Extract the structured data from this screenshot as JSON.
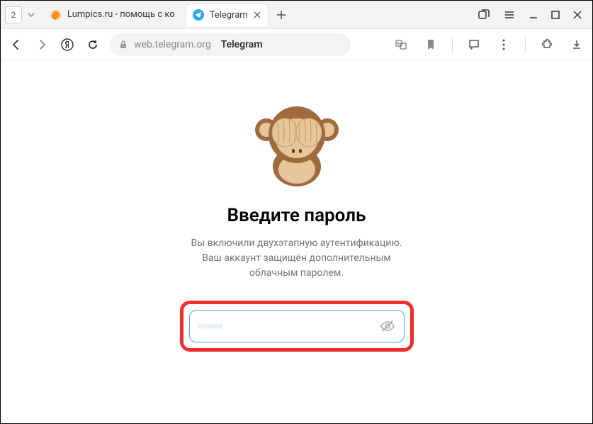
{
  "titlebar": {
    "tab_count": "2",
    "tabs": [
      {
        "title": "Lumpics.ru - помощь с ко"
      },
      {
        "title": "Telegram"
      }
    ]
  },
  "toolbar": {
    "domain": "web.telegram.org",
    "page_title": "Telegram"
  },
  "auth": {
    "heading": "Введите пароль",
    "sub1": "Вы включили двухэтапную аутентификацию.",
    "sub2": "Ваш аккаунт защищён дополнительным",
    "sub3": "облачным паролем.",
    "password_masked": "•••••"
  }
}
